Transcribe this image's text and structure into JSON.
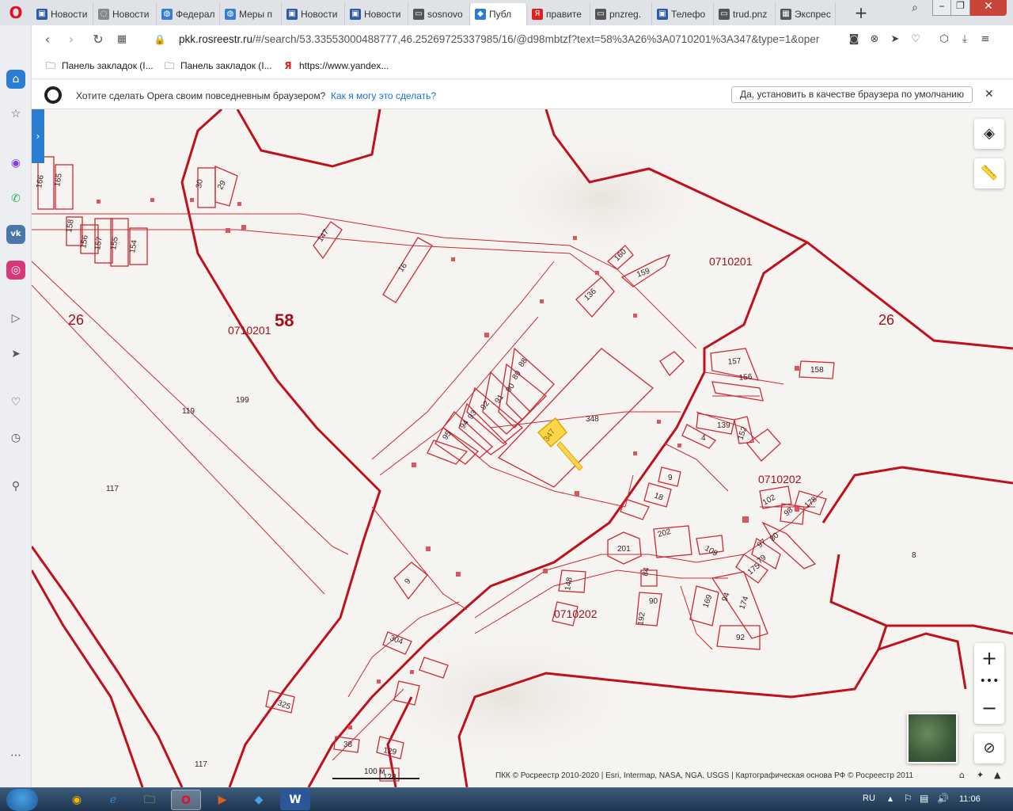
{
  "browser": {
    "menu_logo": "O",
    "tabs": [
      {
        "title": "Новости",
        "color": "#2f5aa8",
        "icon": "news-icon"
      },
      {
        "title": "Новости",
        "color": "#888888",
        "icon": "loading-icon"
      },
      {
        "title": "Федерал",
        "color": "#3a7bd5",
        "icon": "globe-icon"
      },
      {
        "title": "Меры п",
        "color": "#3a7bd5",
        "icon": "globe-icon"
      },
      {
        "title": "Новости",
        "color": "#2f5aa8",
        "icon": "news-icon"
      },
      {
        "title": "Новости",
        "color": "#2f5aa8",
        "icon": "news-icon"
      },
      {
        "title": "sosnovo",
        "color": "#555555",
        "icon": "page-icon"
      },
      {
        "title": "Публ",
        "color": "#2a7dd0",
        "icon": "rosreestr-icon"
      },
      {
        "title": "правите",
        "color": "#e02020",
        "icon": "yandex-icon"
      },
      {
        "title": "pnzreg.",
        "color": "#555555",
        "icon": "page-icon"
      },
      {
        "title": "Телефо",
        "color": "#2f5aa8",
        "icon": "news-icon"
      },
      {
        "title": "trud.pnz",
        "color": "#555555",
        "icon": "page-icon"
      },
      {
        "title": "Экспрес",
        "color": "#555555",
        "icon": "grid-icon"
      }
    ],
    "active_tab_index": 7,
    "address": {
      "host": "pkk.rosreestr.ru",
      "path": "/#/search/53.33553000488777,46.25269725337985/16/@d98mbtzf?text=58%3A26%3A0710201%3A347&type=1&oper"
    },
    "bookmarks": [
      {
        "label": "Панель закладок (I...",
        "icon": "folder-icon"
      },
      {
        "label": "Панель закладок (I...",
        "icon": "folder-icon"
      },
      {
        "label": "https://www.yandex...",
        "icon": "yandex-icon"
      }
    ],
    "notification": {
      "text": "Хотите сделать Opera своим повседневным браузером?",
      "link": "Как я могу это сделать?",
      "button": "Да, установить в качестве браузера по умолчанию"
    }
  },
  "map": {
    "region_label": "58",
    "district_labels": [
      "26",
      "26"
    ],
    "quarter_labels": [
      "0710201",
      "0710201",
      "0710202",
      "0710202"
    ],
    "parcel_labels": [
      "166",
      "165",
      "30",
      "29",
      "158",
      "156",
      "157",
      "155",
      "154",
      "147",
      "16",
      "160",
      "159",
      "136",
      "88",
      "89",
      "90",
      "91",
      "92",
      "93",
      "94",
      "95",
      "348",
      "347",
      "157",
      "156",
      "158",
      "139",
      "152",
      "4",
      "9",
      "18",
      "202",
      "201",
      "109",
      "102",
      "178",
      "98",
      "80",
      "97",
      "79",
      "175",
      "84",
      "90",
      "192",
      "148",
      "169",
      "94",
      "174",
      "92",
      "304",
      "325",
      "38",
      "129",
      "128",
      "199",
      "119",
      "117",
      "117",
      "8",
      "9"
    ],
    "selected_parcel": "347",
    "scale": "100 м",
    "attribution": "ПКК © Росреестр 2010-2020 | Esri, Intermap, NASA, NGA, USGS | Картографическая основа РФ © Росреестр 2011",
    "colors": {
      "boundary": "#c0101e",
      "parcel": "#cc2a33",
      "selected_fill": "#ffd54a",
      "selected_stroke": "#e0a800",
      "background": "#f6f4f1"
    }
  },
  "taskbar": {
    "language": "RU",
    "time": "11:06"
  }
}
